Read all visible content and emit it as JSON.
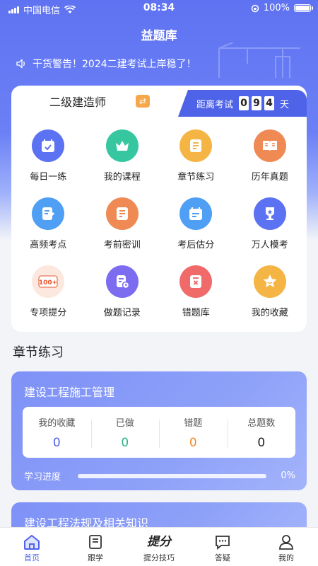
{
  "status_bar": {
    "carrier": "中国电信",
    "time": "08:34",
    "battery": "100%"
  },
  "app_title": "益题库",
  "notice": "干货警告！2024二建考试上岸稳了！",
  "exam": {
    "name": "二级建造师",
    "countdown_label": "距离考试",
    "days_digits": [
      "0",
      "9",
      "4"
    ],
    "days_unit": "天"
  },
  "grid": [
    {
      "label": "每日一练",
      "icon": "calendar-check-icon",
      "color": "#5b72f2"
    },
    {
      "label": "我的课程",
      "icon": "crown-icon",
      "color": "#36c7a0"
    },
    {
      "label": "章节练习",
      "icon": "list-icon",
      "color": "#f5b544"
    },
    {
      "label": "历年真题",
      "icon": "book-open-icon",
      "color": "#f08a55"
    },
    {
      "label": "高频考点",
      "icon": "note-pen-icon",
      "color": "#4fa0f5"
    },
    {
      "label": "考前密训",
      "icon": "document-icon",
      "color": "#f08a55"
    },
    {
      "label": "考后估分",
      "icon": "calendar-score-icon",
      "color": "#4fa0f5"
    },
    {
      "label": "万人模考",
      "icon": "trophy-icon",
      "color": "#5b72f2"
    },
    {
      "label": "专项提分",
      "icon": "score-100-icon",
      "color": "#e8562f"
    },
    {
      "label": "做题记录",
      "icon": "record-clock-icon",
      "color": "#7b6cf0"
    },
    {
      "label": "错题库",
      "icon": "wrong-doc-icon",
      "color": "#f06a6a"
    },
    {
      "label": "我的收藏",
      "icon": "star-icon",
      "color": "#f5b544"
    }
  ],
  "section_title": "章节练习",
  "subjects": [
    {
      "name": "建设工程施工管理",
      "stats": [
        {
          "label": "我的收藏",
          "value": "0",
          "color": "#4e63e8"
        },
        {
          "label": "已做",
          "value": "0",
          "color": "#2bb38a"
        },
        {
          "label": "错题",
          "value": "0",
          "color": "#f08a2a"
        },
        {
          "label": "总题数",
          "value": "0",
          "color": "#222222"
        }
      ],
      "progress_label": "学习进度",
      "progress_text": "0%",
      "progress": 0
    },
    {
      "name": "建设工程法规及相关知识"
    }
  ],
  "tabbar": [
    {
      "label": "首页",
      "icon": "home-icon",
      "active": true
    },
    {
      "label": "跟学",
      "icon": "book-icon",
      "active": false
    },
    {
      "label": "提分技巧",
      "icon": "tifen-logo-icon",
      "active": false
    },
    {
      "label": "答疑",
      "icon": "chat-icon",
      "active": false
    },
    {
      "label": "我的",
      "icon": "user-icon",
      "active": false
    }
  ],
  "tab_logo_text": "提分"
}
